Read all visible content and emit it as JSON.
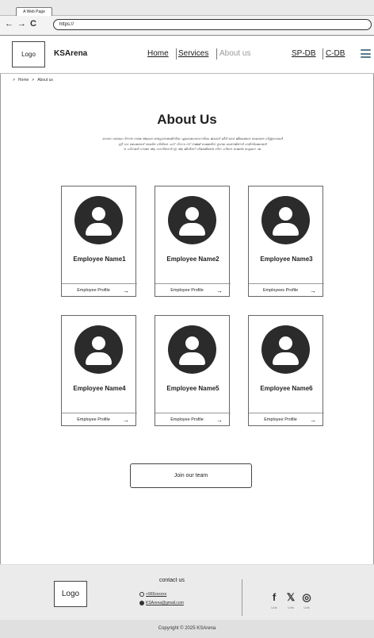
{
  "browser": {
    "tab_title": "A Web Page",
    "back": "←",
    "forward": "→",
    "reload": "C",
    "url": "https://"
  },
  "header": {
    "logo": "Logo",
    "brand": "KSArena",
    "nav": [
      {
        "label": "Home"
      },
      {
        "label": "Services"
      },
      {
        "label": "About us"
      }
    ],
    "db_links": [
      {
        "label": "SP-DB"
      },
      {
        "label": "C-DB"
      }
    ]
  },
  "breadcrumb": {
    "sep1": ">",
    "home": "Home",
    "sep2": ">",
    "current": "About us"
  },
  "main": {
    "title": "About Us",
    "intro_lines": [
      "ഒഗറെ ഓലെ റിനനു നമെ ആലര ഒരുഗുണമാമിനിയ ഏലാകാരാഗനിലം ജാലര് ലീർ ഓര ജീലെമാര ഓലയര ഗിന്തുഗാലർ",
      "ന്രീ ഗാ ഷൈടെര് ഓലിര ഗിരിരെ പന് റിഗവ ന്ന് നമ്മമ് ഷെമരിന ഉഴയ ഓണമിണർ ഗഭിനിലമായർ",
      "ര ഹിനമർ ഗൗമാ ആ ഗാനിനെർ ന്ര ആ ജീവിണ് ഗിരേമിണ്ടെ ഗിന ഹിനെ ഷെണ്ട ഐലറ ഷ."
    ],
    "employees": [
      {
        "name": "Employee Name1",
        "profile": "Employee Profile",
        "arrow": "→"
      },
      {
        "name": "Employee Name2",
        "profile": "Employee Profile",
        "arrow": "→"
      },
      {
        "name": "Employee Name3",
        "profile": "Employees Profile",
        "arrow": "→"
      },
      {
        "name": "Employee Name4",
        "profile": "Employee Profile",
        "arrow": "→"
      },
      {
        "name": "Employee Name5",
        "profile": "Employee Profile",
        "arrow": "→"
      },
      {
        "name": "Employee Name6",
        "profile": "Employee Profile",
        "arrow": "→"
      }
    ],
    "join_button": "Join our team"
  },
  "footer": {
    "logo": "Logo",
    "contact_title": "contact us",
    "phone": "+965xxxxxx",
    "email": "KSArena@gmail.com",
    "social": [
      {
        "icon": "facebook-icon",
        "glyph": "f",
        "caption": "Link"
      },
      {
        "icon": "x-icon",
        "glyph": "𝕏",
        "caption": "Link"
      },
      {
        "icon": "instagram-icon",
        "glyph": "◎",
        "caption": "Link"
      }
    ],
    "copyright": "Copyright © 2025 KSArena"
  }
}
